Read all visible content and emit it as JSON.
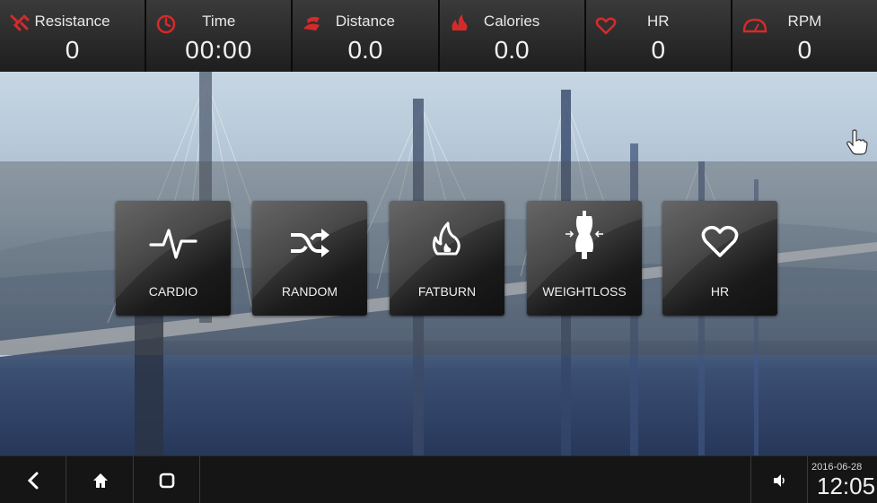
{
  "stats": [
    {
      "id": "resistance",
      "label": "Resistance",
      "value": "0",
      "icon": "resistance-icon"
    },
    {
      "id": "time",
      "label": "Time",
      "value": "00:00",
      "icon": "clock-icon"
    },
    {
      "id": "distance",
      "label": "Distance",
      "value": "0.0",
      "icon": "distance-icon"
    },
    {
      "id": "calories",
      "label": "Calories",
      "value": "0.0",
      "icon": "flame-icon"
    },
    {
      "id": "hr",
      "label": "HR",
      "value": "0",
      "icon": "heart-icon"
    },
    {
      "id": "rpm",
      "label": "RPM",
      "value": "0",
      "icon": "speedometer-icon"
    }
  ],
  "programs": [
    {
      "label": "CARDIO",
      "icon": "pulse-icon"
    },
    {
      "label": "RANDOM",
      "icon": "shuffle-icon"
    },
    {
      "label": "FATBURN",
      "icon": "flame-icon"
    },
    {
      "label": "WEIGHTLOSS",
      "icon": "body-icon"
    },
    {
      "label": "HR",
      "icon": "heart-icon"
    }
  ],
  "system_bar": {
    "back": "back-icon",
    "home": "home-icon",
    "recents": "recents-icon",
    "volume": "volume-icon",
    "date": "2016-06-28",
    "time": "12:05"
  },
  "colors": {
    "stat_icon": "#d62a2a",
    "bar_bg": "#2a2a2a",
    "tile_text": "#ffffff"
  }
}
